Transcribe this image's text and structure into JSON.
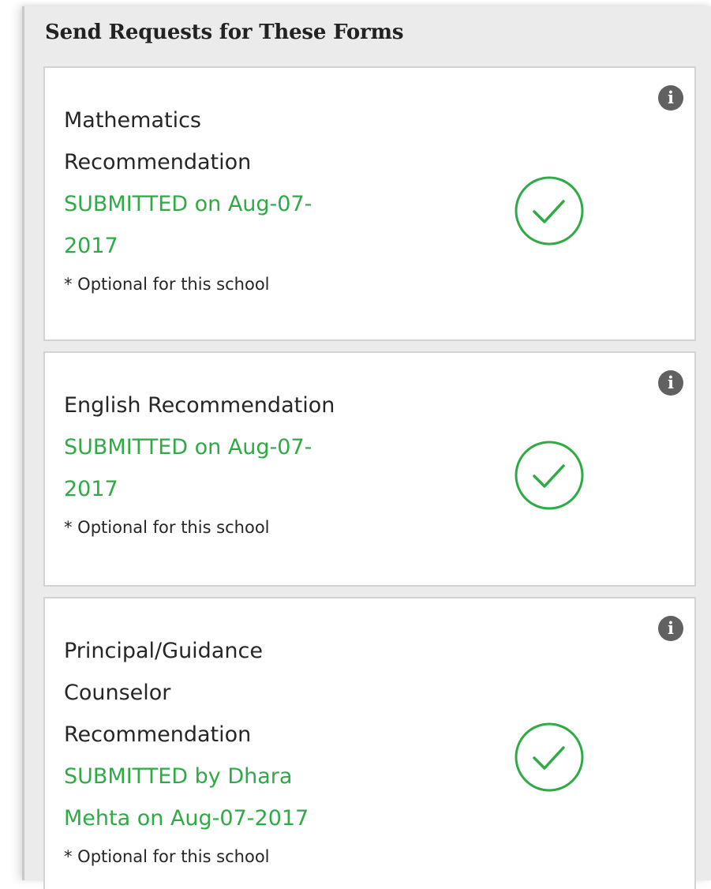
{
  "panel": {
    "title": "Send Requests for These Forms"
  },
  "forms": [
    {
      "name_lines": [
        "Mathematics",
        "Recommendation"
      ],
      "status_lines": [
        "SUBMITTED on Aug-07-",
        "2017"
      ],
      "note": "* Optional for this school",
      "info_icon": "info-icon",
      "status_icon": "check-circle-icon"
    },
    {
      "name_lines": [
        "English Recommendation"
      ],
      "status_lines": [
        "SUBMITTED on Aug-07-",
        "2017"
      ],
      "note": "* Optional for this school",
      "info_icon": "info-icon",
      "status_icon": "check-circle-icon"
    },
    {
      "name_lines": [
        "Principal/Guidance",
        "Counselor",
        "Recommendation"
      ],
      "status_lines": [
        "SUBMITTED by Dhara",
        "Mehta on Aug-07-2017"
      ],
      "note": "* Optional for this school",
      "info_icon": "info-icon",
      "status_icon": "check-circle-icon"
    }
  ],
  "colors": {
    "submitted_green": "#2eab45",
    "panel_background": "#ebebeb",
    "card_border": "#d3d3d3",
    "info_icon": "#616161",
    "text": "#262626"
  }
}
